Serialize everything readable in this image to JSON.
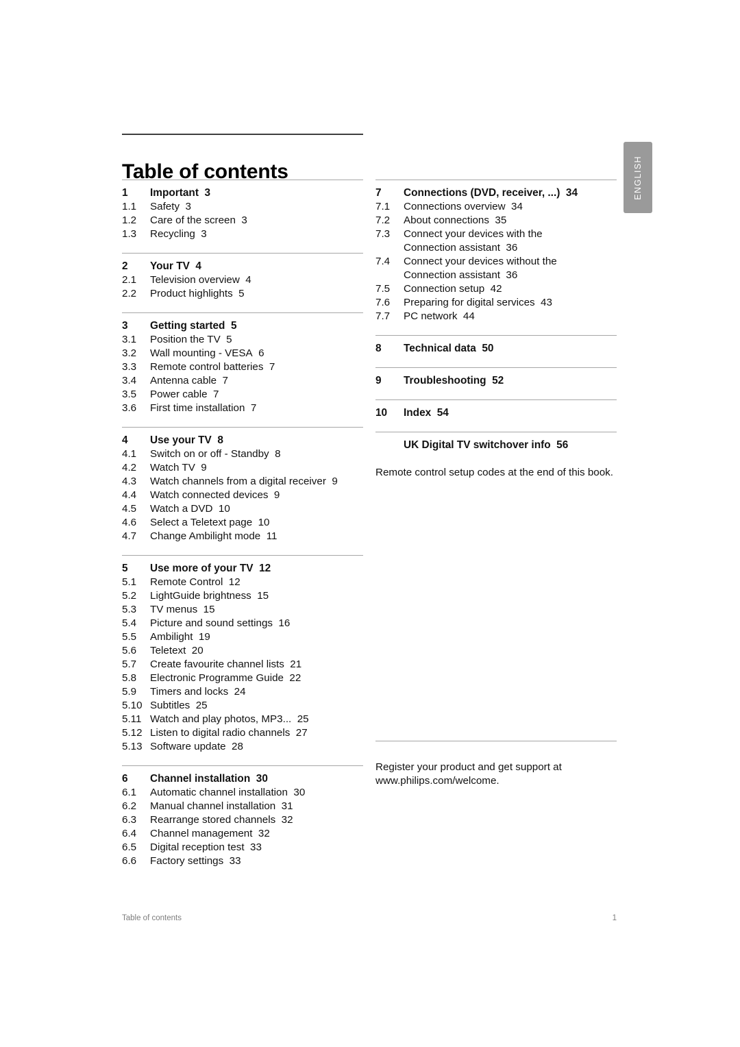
{
  "document": {
    "title": "Table of contents",
    "language_tab": "ENGLISH"
  },
  "footer": {
    "left": "Table of contents",
    "page_number": "1"
  },
  "left_column": {
    "groups": [
      {
        "heading": {
          "number": "1",
          "title": "Important",
          "page": "3"
        },
        "entries": [
          {
            "number": "1.1",
            "title": "Safety",
            "page": "3"
          },
          {
            "number": "1.2",
            "title": "Care of the screen",
            "page": "3"
          },
          {
            "number": "1.3",
            "title": "Recycling",
            "page": "3"
          }
        ]
      },
      {
        "heading": {
          "number": "2",
          "title": "Your TV",
          "page": "4"
        },
        "entries": [
          {
            "number": "2.1",
            "title": "Television overview",
            "page": "4"
          },
          {
            "number": "2.2",
            "title": "Product highlights",
            "page": "5"
          }
        ]
      },
      {
        "heading": {
          "number": "3",
          "title": "Getting started",
          "page": "5"
        },
        "entries": [
          {
            "number": "3.1",
            "title": "Position the TV",
            "page": "5"
          },
          {
            "number": "3.2",
            "title": "Wall mounting - VESA",
            "page": "6"
          },
          {
            "number": "3.3",
            "title": "Remote control batteries",
            "page": "7"
          },
          {
            "number": "3.4",
            "title": "Antenna cable",
            "page": "7"
          },
          {
            "number": "3.5",
            "title": "Power cable",
            "page": "7"
          },
          {
            "number": "3.6",
            "title": "First time installation",
            "page": "7"
          }
        ]
      },
      {
        "heading": {
          "number": "4",
          "title": "Use your TV",
          "page": "8"
        },
        "entries": [
          {
            "number": "4.1",
            "title": "Switch on or off - Standby",
            "page": "8"
          },
          {
            "number": "4.2",
            "title": "Watch TV",
            "page": "9"
          },
          {
            "number": "4.3",
            "title": "Watch channels from a digital receiver",
            "page": "9"
          },
          {
            "number": "4.4",
            "title": "Watch connected devices",
            "page": "9"
          },
          {
            "number": "4.5",
            "title": "Watch a DVD",
            "page": "10"
          },
          {
            "number": "4.6",
            "title": "Select a Teletext page",
            "page": "10"
          },
          {
            "number": "4.7",
            "title": "Change Ambilight mode",
            "page": "11"
          }
        ]
      },
      {
        "heading": {
          "number": "5",
          "title": "Use more of your TV",
          "page": "12"
        },
        "entries": [
          {
            "number": "5.1",
            "title": "Remote Control",
            "page": "12"
          },
          {
            "number": "5.2",
            "title": "LightGuide brightness",
            "page": "15"
          },
          {
            "number": "5.3",
            "title": "TV menus",
            "page": "15"
          },
          {
            "number": "5.4",
            "title": "Picture and sound settings",
            "page": "16"
          },
          {
            "number": "5.5",
            "title": "Ambilight",
            "page": "19"
          },
          {
            "number": "5.6",
            "title": "Teletext",
            "page": "20"
          },
          {
            "number": "5.7",
            "title": "Create favourite channel lists",
            "page": "21"
          },
          {
            "number": "5.8",
            "title": "Electronic Programme Guide",
            "page": "22"
          },
          {
            "number": "5.9",
            "title": "Timers and locks",
            "page": "24"
          },
          {
            "number": "5.10",
            "title": "Subtitles",
            "page": "25"
          },
          {
            "number": "5.11",
            "title": "Watch and play photos, MP3...",
            "page": "25"
          },
          {
            "number": "5.12",
            "title": "Listen to digital radio channels",
            "page": "27"
          },
          {
            "number": "5.13",
            "title": "Software update",
            "page": "28"
          }
        ]
      },
      {
        "heading": {
          "number": "6",
          "title": "Channel installation",
          "page": "30"
        },
        "entries": [
          {
            "number": "6.1",
            "title": "Automatic channel installation",
            "page": "30"
          },
          {
            "number": "6.2",
            "title": "Manual channel installation",
            "page": "31"
          },
          {
            "number": "6.3",
            "title": "Rearrange stored channels",
            "page": "32"
          },
          {
            "number": "6.4",
            "title": "Channel management",
            "page": "32"
          },
          {
            "number": "6.5",
            "title": "Digital reception test",
            "page": "33"
          },
          {
            "number": "6.6",
            "title": "Factory settings",
            "page": "33"
          }
        ]
      }
    ]
  },
  "right_column": {
    "groups": [
      {
        "heading": {
          "number": "7",
          "title": "Connections (DVD, receiver, ...)",
          "page": "34"
        },
        "entries": [
          {
            "number": "7.1",
            "title": "Connections overview",
            "page": "34"
          },
          {
            "number": "7.2",
            "title": "About connections",
            "page": "35"
          },
          {
            "number": "7.3",
            "title": "Connect your devices with the",
            "page": ""
          },
          {
            "number": "",
            "title": "Connection assistant",
            "page": "36"
          },
          {
            "number": "7.4",
            "title": "Connect your devices without the",
            "page": ""
          },
          {
            "number": "",
            "title": "Connection assistant",
            "page": "36"
          },
          {
            "number": "7.5",
            "title": "Connection setup",
            "page": "42"
          },
          {
            "number": "7.6",
            "title": "Preparing for digital services",
            "page": "43"
          },
          {
            "number": "7.7",
            "title": "PC network",
            "page": "44"
          }
        ]
      },
      {
        "heading": {
          "number": "8",
          "title": "Technical data",
          "page": "50"
        },
        "entries": []
      },
      {
        "heading": {
          "number": "9",
          "title": "Troubleshooting",
          "page": "52"
        },
        "entries": []
      },
      {
        "heading": {
          "number": "10",
          "title": "Index",
          "page": "54"
        },
        "entries": []
      },
      {
        "heading": {
          "number": "",
          "title": "UK Digital TV switchover info",
          "page": "56"
        },
        "entries": []
      }
    ],
    "note": "Remote control setup codes at the end of this book.",
    "register_note": "Register your product and get support at www.philips.com/welcome."
  }
}
